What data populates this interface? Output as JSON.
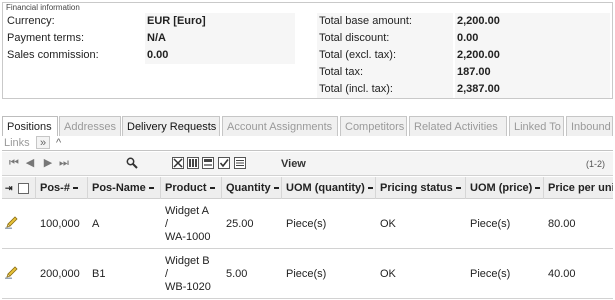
{
  "financial": {
    "legend": "Financial information",
    "left": [
      {
        "label": "Currency:",
        "value": "EUR [Euro]"
      },
      {
        "label": "Payment terms:",
        "value": "N/A"
      },
      {
        "label": "Sales commission:",
        "value": "0.00"
      }
    ],
    "right": [
      {
        "label": "Total base amount:",
        "value": "2,200.00"
      },
      {
        "label": "Total discount:",
        "value": "0.00"
      },
      {
        "label": "Total (excl. tax):",
        "value": "2,200.00"
      },
      {
        "label": "Total tax:",
        "value": "187.00"
      },
      {
        "label": "Total (incl. tax):",
        "value": "2,387.00"
      }
    ]
  },
  "tabs": [
    {
      "label": "Positions",
      "state": "active"
    },
    {
      "label": "Addresses",
      "state": "inactive"
    },
    {
      "label": "Delivery Requests",
      "state": "strong"
    },
    {
      "label": "Account Assignments",
      "state": "inactive"
    },
    {
      "label": "Competitors",
      "state": "inactive"
    },
    {
      "label": "Related Activities",
      "state": "inactive"
    },
    {
      "label": "Linked To",
      "state": "inactive"
    },
    {
      "label": "Inbound",
      "state": "inactive"
    }
  ],
  "tabs_row2": {
    "label": "Links",
    "more": "»",
    "up": "^"
  },
  "toolbar": {
    "view_label": "View",
    "count": "(1-2)"
  },
  "table": {
    "columns": [
      "Pos-#",
      "Pos-Name",
      "Product",
      "Quantity",
      "UOM (quantity)",
      "Pricing status",
      "UOM (price)",
      "Price per unit"
    ],
    "rows": [
      {
        "pos": "100,000",
        "name": "A",
        "product": [
          "Widget A",
          "/",
          "WA-1000"
        ],
        "quantity": "25.00",
        "uom_q": "Piece(s)",
        "status": "OK",
        "uom_p": "Piece(s)",
        "price": "80.00"
      },
      {
        "pos": "200,000",
        "name": "B1",
        "product": [
          "Widget B",
          "/",
          "WB-1020"
        ],
        "quantity": "5.00",
        "uom_q": "Piece(s)",
        "status": "OK",
        "uom_p": "Piece(s)",
        "price": "40.00"
      }
    ]
  },
  "icons": [
    "first-page-icon",
    "previous-page-icon",
    "next-page-icon",
    "last-page-icon",
    "search-icon",
    "delete-icon",
    "columns-icon",
    "export-icon",
    "check-icon",
    "list-icon",
    "edit-pencil-icon"
  ]
}
